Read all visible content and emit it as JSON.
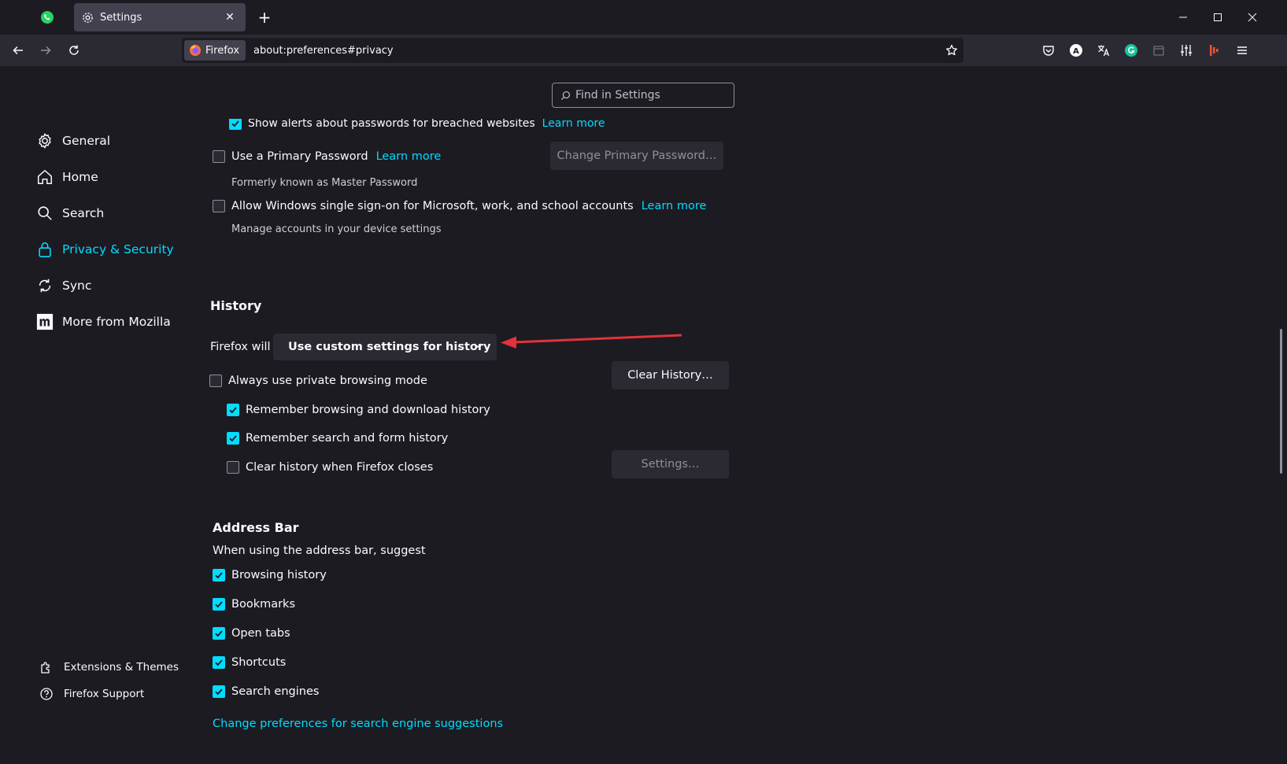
{
  "tab": {
    "title": "Settings"
  },
  "urlbar": {
    "identity": "Firefox",
    "url": "about:preferences#privacy"
  },
  "search": {
    "placeholder": "Find in Settings"
  },
  "sidebar": {
    "items": [
      {
        "label": "General",
        "icon": "gear-icon"
      },
      {
        "label": "Home",
        "icon": "home-icon"
      },
      {
        "label": "Search",
        "icon": "search-icon"
      },
      {
        "label": "Privacy & Security",
        "icon": "lock-icon",
        "active": true
      },
      {
        "label": "Sync",
        "icon": "sync-icon"
      },
      {
        "label": "More from Mozilla",
        "icon": "mozilla-icon"
      }
    ],
    "footer": [
      {
        "label": "Extensions & Themes",
        "icon": "puzzle-icon"
      },
      {
        "label": "Firefox Support",
        "icon": "help-icon"
      }
    ]
  },
  "logins": {
    "breach_alerts": "Show alerts about passwords for breached websites",
    "breach_learn": "Learn more",
    "primary_password": "Use a Primary Password",
    "primary_learn": "Learn more",
    "primary_note": "Formerly known as Master Password",
    "change_primary": "Change Primary Password…",
    "sso": "Allow Windows single sign-on for Microsoft, work, and school accounts",
    "sso_learn": "Learn more",
    "sso_note": "Manage accounts in your device settings"
  },
  "history": {
    "heading": "History",
    "firefox_will": "Firefox will",
    "mode": "Use custom settings for history",
    "always_private": "Always use private browsing mode",
    "clear_history": "Clear History…",
    "remember_browsing": "Remember browsing and download history",
    "remember_search": "Remember search and form history",
    "clear_on_close": "Clear history when Firefox closes",
    "settings": "Settings…"
  },
  "address_bar": {
    "heading": "Address Bar",
    "subtitle": "When using the address bar, suggest",
    "options": [
      {
        "label": "Browsing history",
        "checked": true
      },
      {
        "label": "Bookmarks",
        "checked": true
      },
      {
        "label": "Open tabs",
        "checked": true
      },
      {
        "label": "Shortcuts",
        "checked": true
      },
      {
        "label": "Search engines",
        "checked": true
      }
    ],
    "change_link": "Change preferences for search engine suggestions"
  },
  "colors": {
    "accent": "#00ddff",
    "arrow": "#e0333a",
    "bg": "#1c1b22"
  }
}
